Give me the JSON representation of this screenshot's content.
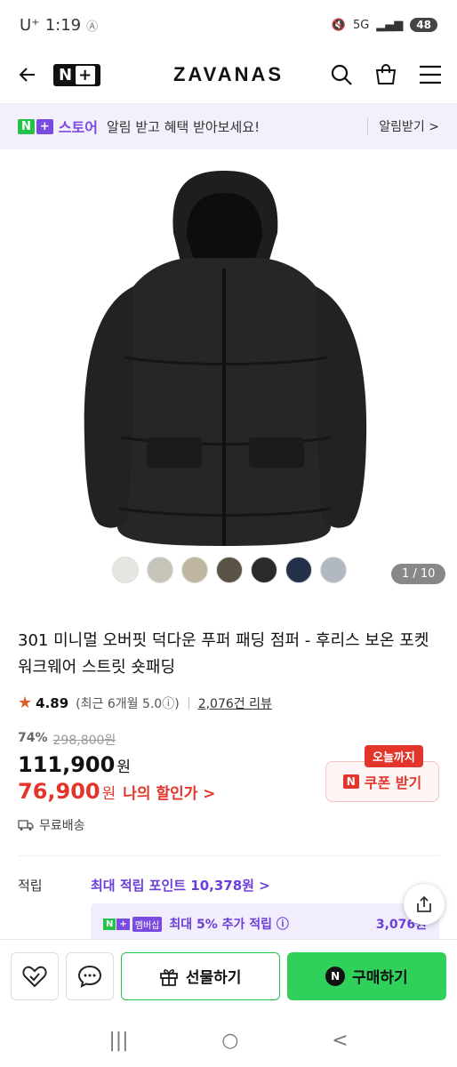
{
  "status": {
    "carrier": "U⁺",
    "time": "1:19",
    "extra": "Ⓐ",
    "network": "5G",
    "battery": "48"
  },
  "header": {
    "nplus_n": "N",
    "nplus_plus": "+",
    "brand": "ZAVANAS"
  },
  "banner": {
    "store_n": "N",
    "store_plus": "+",
    "store_label": "스토어",
    "text": "알림 받고 혜택 받아보세요!",
    "link": "알림받기 >"
  },
  "product": {
    "swatch_colors": [
      "#e8e6e1",
      "#c6c4b8",
      "#bfb6a0",
      "#5a5346",
      "#2a2a2a",
      "#25304a",
      "#b2b8bf"
    ],
    "image_counter": "1 / 10",
    "title": "301 미니멀 오버핏 덕다운 푸퍼 패딩 점퍼 - 후리스 보온 포켓 워크웨어 스트릿 숏패딩",
    "rating": "4.89",
    "rating_sub": "(최근 6개월 5.0ⓘ)",
    "reviews": "2,076건 리뷰",
    "discount_pct": "74%",
    "original_price": "298,800원",
    "price": "111,900",
    "price_unit": "원",
    "my_price": "76,900",
    "my_price_unit": "원",
    "my_discount_label": "나의 할인가 >",
    "coupon_tag": "오늘까지",
    "coupon_n": "N",
    "coupon_label": "쿠폰 받기",
    "shipping": "무료배송"
  },
  "points": {
    "label": "적립",
    "value": "최대 적립 포인트 10,378원 >",
    "member_n": "N",
    "member_plus": "+",
    "member_tag": "멤버십",
    "member_text": "최대 5% 추가 적립 ⓘ",
    "member_amount": "3,076원"
  },
  "bottom": {
    "gift_label": "선물하기",
    "buy_n": "N",
    "buy_label": "구매하기"
  },
  "nav": {
    "recent": "|||",
    "home": "○",
    "back": "<"
  }
}
